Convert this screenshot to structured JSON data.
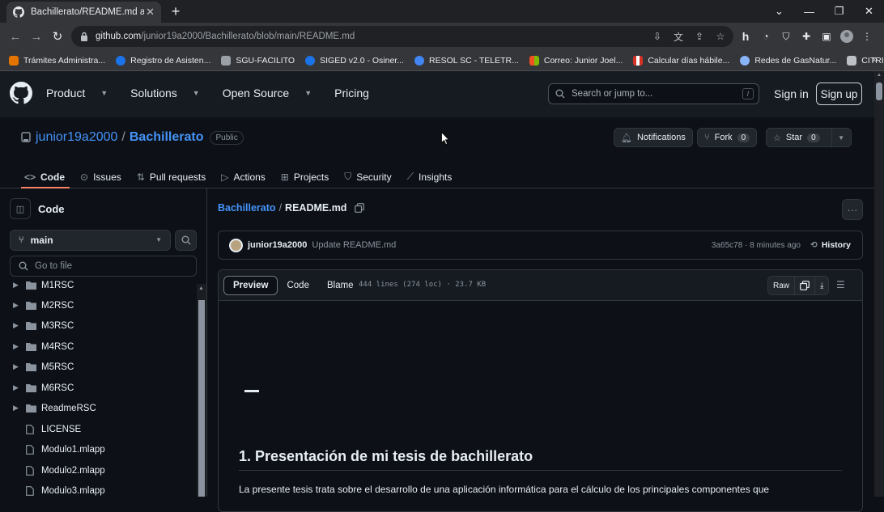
{
  "browser": {
    "tab_title": "Bachillerato/README.md at main",
    "url_host": "github.com",
    "url_path": "/junior19a2000/Bachillerato/blob/main/README.md",
    "bookmarks": [
      {
        "label": "Trámites Administra...",
        "color": "#e37400"
      },
      {
        "label": "Registro de Asisten...",
        "color": "#1a73e8"
      },
      {
        "label": "SGU-FACILITO",
        "color": "#9aa0a6"
      },
      {
        "label": "SIGED v2.0 - Osiner...",
        "color": "#1a73e8"
      },
      {
        "label": "RESOL SC - TELETR...",
        "color": "#4285f4"
      },
      {
        "label": "Correo: Junior Joel...",
        "color": "#f25022"
      },
      {
        "label": "Calcular días hábile...",
        "color": "#d93025"
      },
      {
        "label": "Redes de GasNatur...",
        "color": "#8ab4f8"
      },
      {
        "label": "CITRIX",
        "color": "#bdc1c6"
      }
    ]
  },
  "github": {
    "nav": [
      "Product",
      "Solutions",
      "Open Source",
      "Pricing"
    ],
    "search_placeholder": "Search or jump to...",
    "search_key": "/",
    "sign_in": "Sign in",
    "sign_up": "Sign up"
  },
  "repo": {
    "owner": "junior19a2000",
    "name": "Bachillerato",
    "visibility": "Public",
    "notifications": "Notifications",
    "fork_label": "Fork",
    "fork_count": "0",
    "star_label": "Star",
    "star_count": "0",
    "tabs": [
      "Code",
      "Issues",
      "Pull requests",
      "Actions",
      "Projects",
      "Security",
      "Insights"
    ],
    "selected_tab": "Code"
  },
  "sidebar": {
    "title": "Code",
    "branch": "main",
    "goto_placeholder": "Go to file",
    "tree": [
      {
        "name": "M1RSC",
        "type": "folder"
      },
      {
        "name": "M2RSC",
        "type": "folder"
      },
      {
        "name": "M3RSC",
        "type": "folder"
      },
      {
        "name": "M4RSC",
        "type": "folder"
      },
      {
        "name": "M5RSC",
        "type": "folder"
      },
      {
        "name": "M6RSC",
        "type": "folder"
      },
      {
        "name": "ReadmeRSC",
        "type": "folder"
      },
      {
        "name": "LICENSE",
        "type": "file"
      },
      {
        "name": "Modulo1.mlapp",
        "type": "file"
      },
      {
        "name": "Modulo2.mlapp",
        "type": "file"
      },
      {
        "name": "Modulo3.mlapp",
        "type": "file"
      }
    ]
  },
  "file": {
    "breadcrumb_repo": "Bachillerato",
    "breadcrumb_sep": "/",
    "breadcrumb_file": "README.md",
    "commit_user": "junior19a2000",
    "commit_message": "Update README.md",
    "commit_meta": "3a65c78 · 8 minutes ago",
    "history": "History",
    "view_tabs": [
      "Preview",
      "Code",
      "Blame"
    ],
    "meta": "444 lines (274 loc) · 23.7 KB",
    "raw": "Raw",
    "heading": "1. Presentación de mi tesis de bachillerato",
    "paragraph": "La presente tesis trata sobre el desarrollo de una aplicación informática para el cálculo de los principales componentes que"
  }
}
